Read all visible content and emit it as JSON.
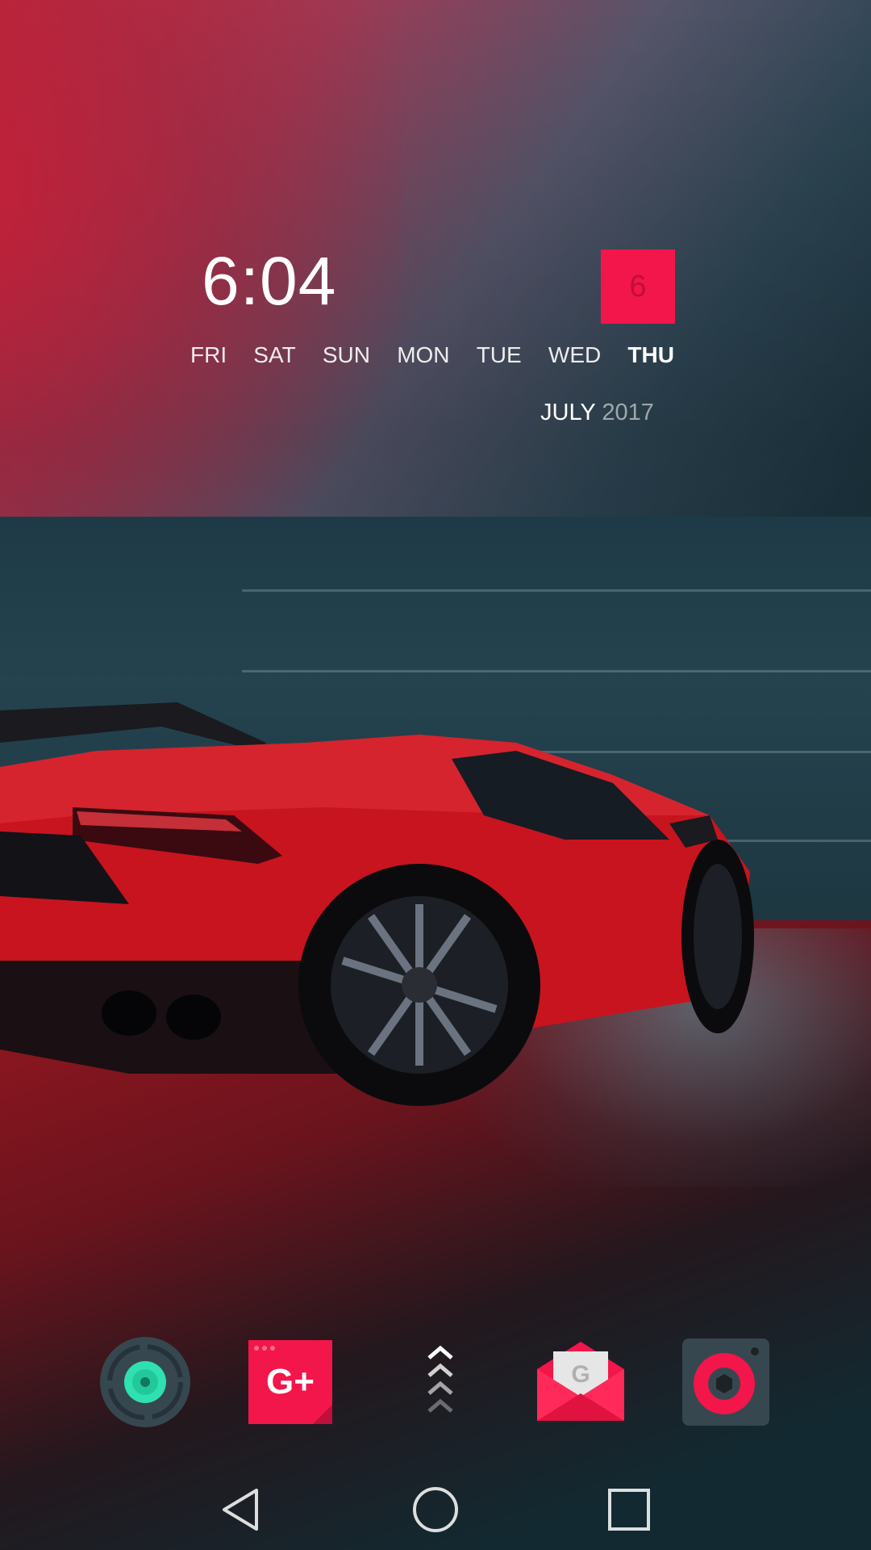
{
  "clock_widget": {
    "time": "6:04",
    "date_number": "6",
    "weekdays": [
      "FRI",
      "SAT",
      "SUN",
      "MON",
      "TUE",
      "WED",
      "THU"
    ],
    "active_weekday": "THU",
    "month": "JULY",
    "year": "2017",
    "accent_color": "#f2164b"
  },
  "dock": {
    "apps": [
      {
        "icon": "camera-lens-icon",
        "color": "#2fe0b0"
      },
      {
        "icon": "google-plus-icon",
        "color": "#f2164b"
      },
      {
        "icon": "app-drawer-chevrons-icon",
        "color": "#ffffff"
      },
      {
        "icon": "gmail-envelope-icon",
        "color": "#f2164b"
      },
      {
        "icon": "music-player-icon",
        "color": "#f2164b"
      }
    ]
  },
  "navigation": {
    "buttons": [
      "back-icon",
      "home-icon",
      "recents-icon"
    ]
  }
}
